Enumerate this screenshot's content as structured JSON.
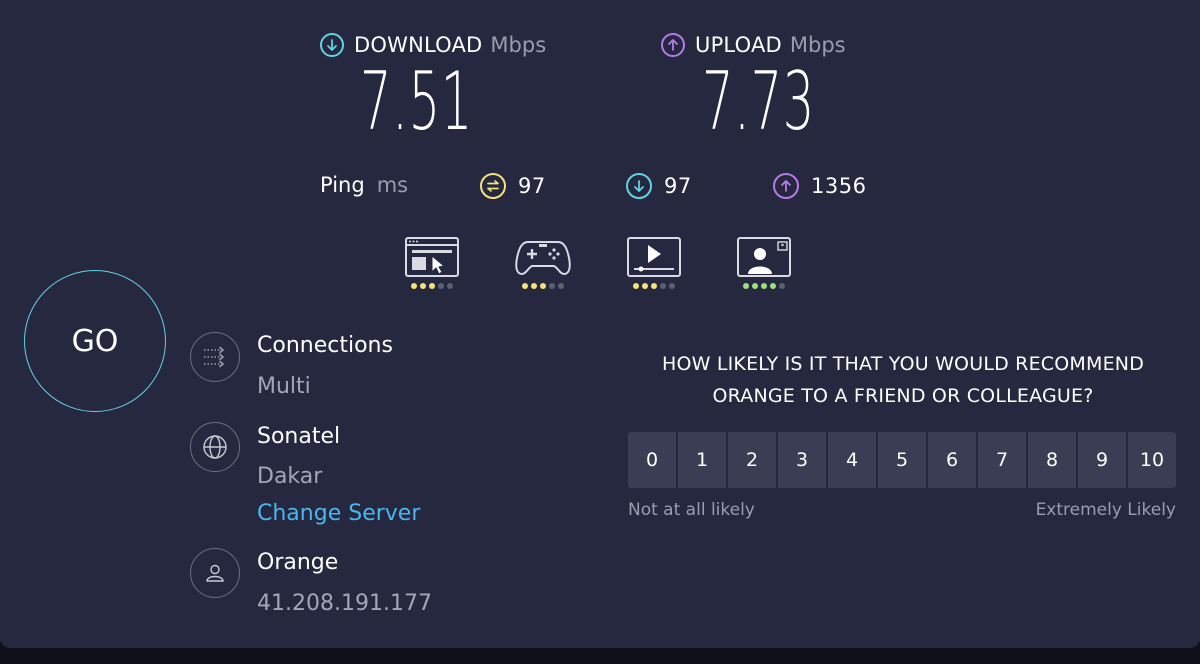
{
  "download": {
    "title": "DOWNLOAD",
    "unit": "Mbps",
    "value": "7.51",
    "color": "#5fd4e3"
  },
  "upload": {
    "title": "UPLOAD",
    "unit": "Mbps",
    "value": "7.73",
    "color": "#b77be6"
  },
  "ping": {
    "label": "Ping",
    "unit": "ms",
    "idle": {
      "value": "97",
      "icon": "ping-idle-icon",
      "color": "#f6e27a"
    },
    "down": {
      "value": "97",
      "icon": "download-latency-icon",
      "color": "#5fd4e3"
    },
    "up": {
      "value": "1356",
      "icon": "upload-latency-icon",
      "color": "#b77be6"
    }
  },
  "quality": [
    {
      "icon": "web-browsing-icon",
      "rating": 3,
      "of": 5,
      "color": "#f6e27a"
    },
    {
      "icon": "gaming-icon",
      "rating": 3,
      "of": 5,
      "color": "#f6e27a"
    },
    {
      "icon": "video-streaming-icon",
      "rating": 3,
      "of": 5,
      "color": "#f6e27a"
    },
    {
      "icon": "video-chat-icon",
      "rating": 4,
      "of": 5,
      "color": "#9ee07c"
    }
  ],
  "go_label": "GO",
  "connections": {
    "title": "Connections",
    "value": "Multi"
  },
  "server": {
    "name": "Sonatel",
    "location": "Dakar",
    "change_label": "Change Server"
  },
  "isp": {
    "name": "Orange",
    "ip": "41.208.191.177"
  },
  "survey": {
    "line1": "HOW LIKELY IS IT THAT YOU WOULD RECOMMEND",
    "line2": "ORANGE TO A FRIEND OR COLLEAGUE?",
    "scale": [
      "0",
      "1",
      "2",
      "3",
      "4",
      "5",
      "6",
      "7",
      "8",
      "9",
      "10"
    ],
    "low_label": "Not at all likely",
    "high_label": "Extremely Likely"
  }
}
